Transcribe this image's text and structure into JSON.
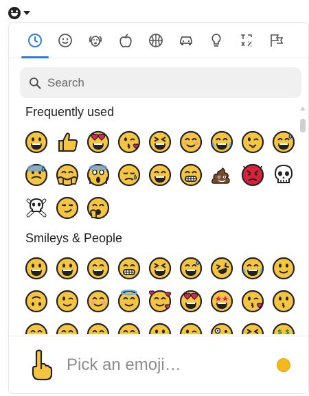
{
  "search": {
    "placeholder": "Search"
  },
  "tabs": [
    {
      "name": "tab-frequently-used",
      "icon": "clock-icon",
      "active": true
    },
    {
      "name": "tab-smileys-people",
      "icon": "smiley-icon"
    },
    {
      "name": "tab-animals-nature",
      "icon": "dog-icon"
    },
    {
      "name": "tab-food-drink",
      "icon": "apple-icon"
    },
    {
      "name": "tab-activity",
      "icon": "basketball-icon"
    },
    {
      "name": "tab-travel-places",
      "icon": "car-icon"
    },
    {
      "name": "tab-objects",
      "icon": "lightbulb-icon"
    },
    {
      "name": "tab-symbols",
      "icon": "symbols-icon"
    },
    {
      "name": "tab-flags",
      "icon": "flags-icon"
    }
  ],
  "sections": [
    {
      "title": "Frequently used",
      "emojis": [
        "grinning",
        "thumbs-up",
        "heart-eyes",
        "kissing-heart",
        "laughing",
        "blush",
        "joy",
        "wink-tongue",
        "sweat-smile",
        "cold-sweat",
        "hugging",
        "scream",
        "sad-relieved",
        "smile",
        "grin",
        "poop",
        "devil",
        "skull",
        "crossbones",
        "smirk",
        "yawning"
      ]
    },
    {
      "title": "Smileys & People",
      "emojis": [
        "grinning",
        "smiley",
        "smile",
        "grin",
        "laughing",
        "sweat-smile",
        "rofl",
        "joy",
        "slightly-smiling",
        "upside-down",
        "wink",
        "blush",
        "innocent",
        "smiling-hearts",
        "heart-eyes",
        "star-struck",
        "kissing-heart",
        "kissing",
        "relaxed",
        "kissing-closed-eyes",
        "kissing-smiling",
        "yum",
        "tongue",
        "wink-tongue",
        "zany",
        "squint-tongue",
        "money-mouth"
      ]
    }
  ],
  "footer": {
    "preview_label": "Pick an emoji…",
    "preview_icon": "pointing-up-icon",
    "skin_tone_color": "#f5b81b"
  },
  "colors": {
    "accent": "#2a7be4",
    "emoji_yellow": "#f5c542",
    "emoji_outline": "#222222"
  }
}
